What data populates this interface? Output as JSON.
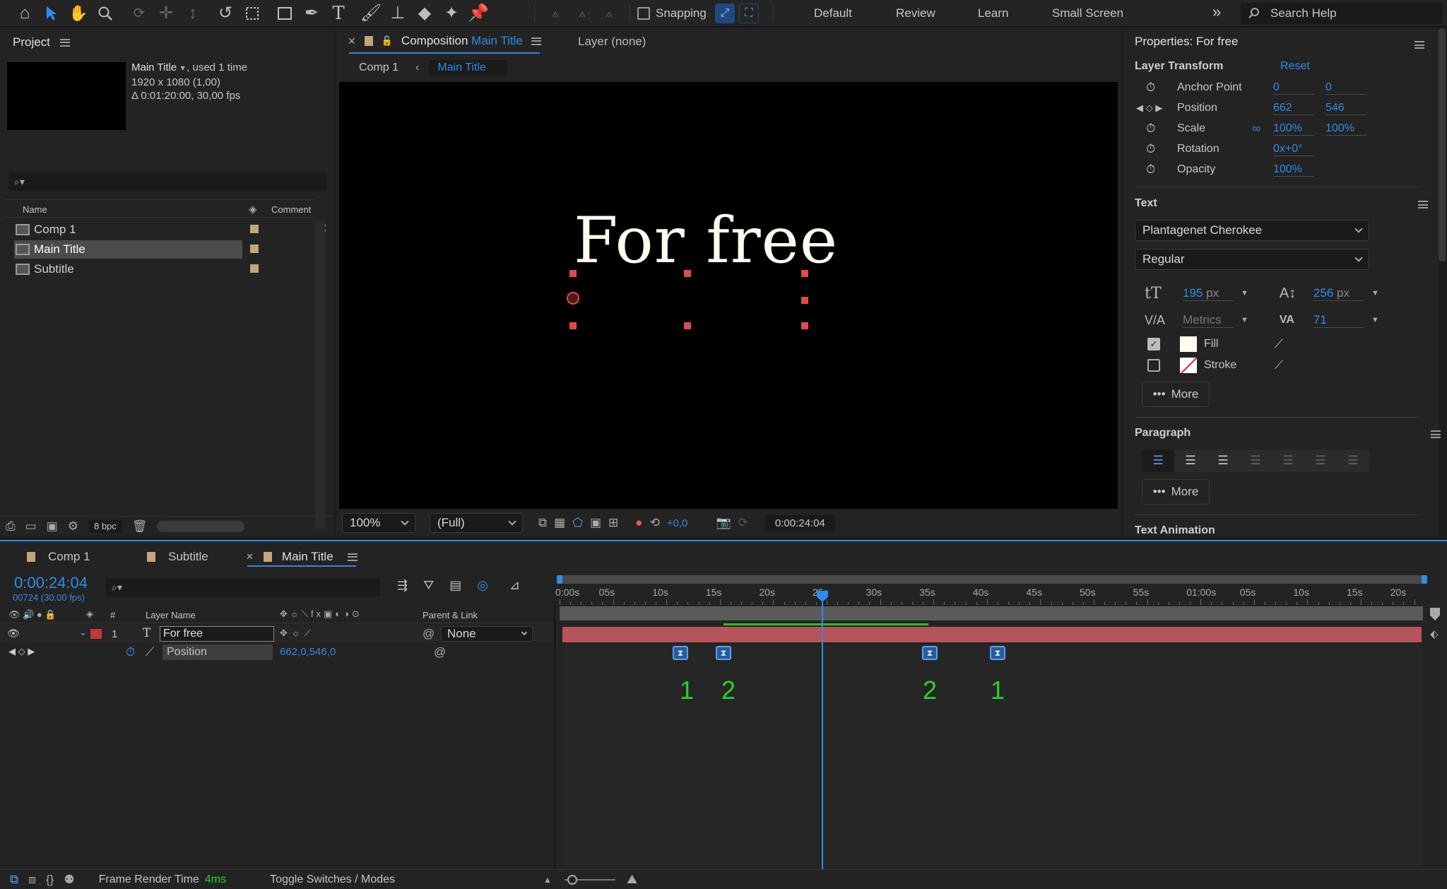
{
  "toolbar": {
    "snapping_label": "Snapping",
    "workspaces": [
      "Default",
      "Review",
      "Learn",
      "Small Screen"
    ],
    "search_placeholder": "Search Help",
    "overflow_icon": "chevron-double-right-icon",
    "tools": [
      "home-icon",
      "selection-arrow-icon",
      "hand-icon",
      "zoom-icon",
      "orbit-icon",
      "pan-behind-icon",
      "track-z-icon",
      "rotate-icon",
      "region-icon",
      "rectangle-icon",
      "pen-icon",
      "text-icon",
      "brush-icon",
      "clone-stamp-icon",
      "eraser-icon",
      "roto-brush-icon",
      "puppet-pin-icon"
    ]
  },
  "project": {
    "title": "Project",
    "selected_name": "Main Title",
    "used": ", used 1 time",
    "dims": "1920 x 1080 (1,00)",
    "duration": "Δ 0:01:20:00, 30,00 fps",
    "col_name": "Name",
    "col_comment": "Comment",
    "items": [
      {
        "label": "Comp 1"
      },
      {
        "label": "Main Title"
      },
      {
        "label": "Subtitle"
      }
    ],
    "bpc": "8 bpc"
  },
  "composition": {
    "tab_prefix": "Composition",
    "tab_name": "Main Title",
    "layer_tab": "Layer (none)",
    "crumb_1": "Comp 1",
    "crumb_2": "Main Title",
    "canvas_text": "For free",
    "zoom": "100%",
    "resolution": "(Full)",
    "exposure": "+0,0",
    "timecode": "0:00:24:04"
  },
  "properties": {
    "title": "Properties: For free",
    "layer_transform": "Layer Transform",
    "reset": "Reset",
    "anchor_label": "Anchor Point",
    "anchor_x": "0",
    "anchor_y": "0",
    "position_label": "Position",
    "position_x": "662",
    "position_y": "546",
    "scale_label": "Scale",
    "scale_x": "100",
    "scale_y": "100",
    "pct": "%",
    "rotation_label": "Rotation",
    "rotation": "0x+0°",
    "opacity_label": "Opacity",
    "opacity": "100",
    "text_section": "Text",
    "font": "Plantagenet Cherokee",
    "style": "Regular",
    "size": "195",
    "px": "px",
    "leading": "256",
    "kerning": "Metrics",
    "tracking": "71",
    "fill": "Fill",
    "stroke": "Stroke",
    "more": "More",
    "paragraph": "Paragraph",
    "text_animation": "Text Animation"
  },
  "timeline": {
    "tabs": [
      {
        "label": "Comp 1"
      },
      {
        "label": "Subtitle"
      },
      {
        "label": "Main Title"
      }
    ],
    "timecode": "0:00:24:04",
    "frames": "00724 (30.00 fps)",
    "col_num": "#",
    "col_layer": "Layer Name",
    "col_parent": "Parent & Link",
    "layer_index": "1",
    "layer_name": "For free",
    "parent": "None",
    "prop_name": "Position",
    "prop_value": "662,0,546,0",
    "ruler": [
      "0:00s",
      "05s",
      "10s",
      "15s",
      "20s",
      "25s",
      "30s",
      "35s",
      "40s",
      "45s",
      "50s",
      "55s",
      "01:00s",
      "05s",
      "10s",
      "15s",
      "20s"
    ],
    "kf_labels": [
      "1",
      "2",
      "2",
      "1"
    ],
    "frame_render": "Frame Render Time",
    "frame_render_value": "4ms",
    "toggle": "Toggle Switches / Modes"
  },
  "colors": {
    "accent": "#2d8ceb",
    "layer_bar": "#b5545a",
    "label_red": "#c2373b",
    "swatch": "#c2a77a",
    "annotation_green": "#27d327"
  }
}
